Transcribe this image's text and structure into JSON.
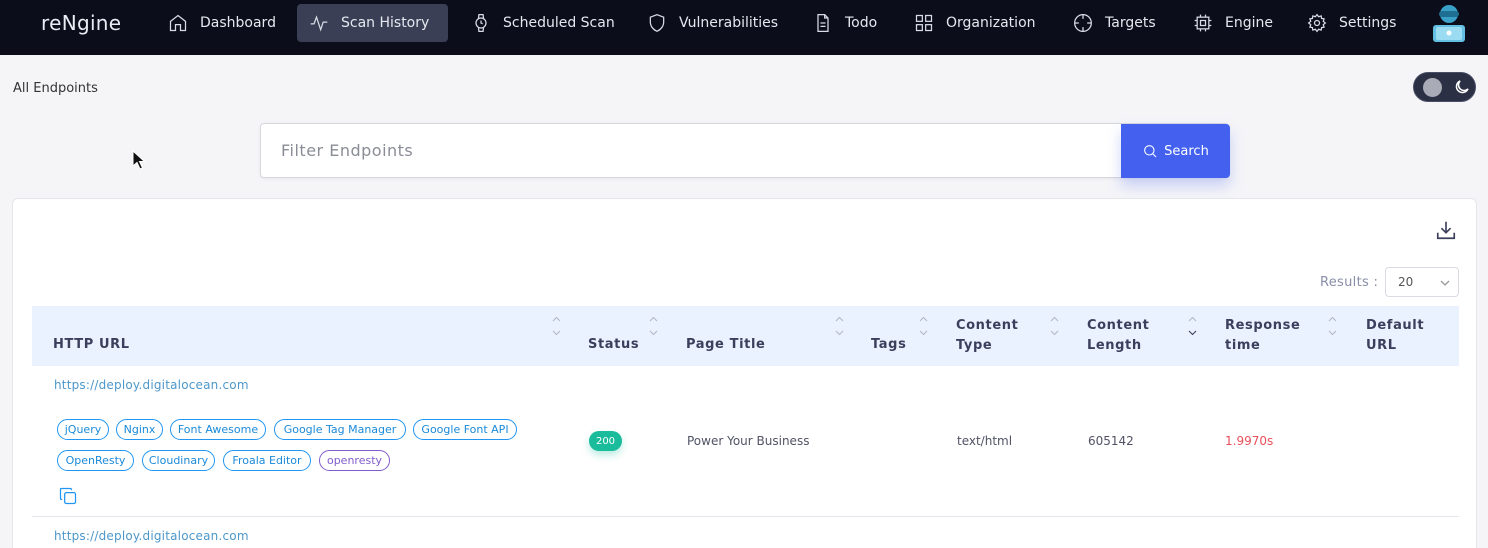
{
  "app": {
    "brand": "reNgine"
  },
  "nav": {
    "dashboard": "Dashboard",
    "scan_history": "Scan History",
    "scheduled_scan": "Scheduled Scan",
    "vulnerabilities": "Vulnerabilities",
    "todo": "Todo",
    "organization": "Organization",
    "targets": "Targets",
    "engine": "Engine",
    "settings": "Settings"
  },
  "page": {
    "title": "All Endpoints"
  },
  "search": {
    "placeholder": "Filter Endpoints",
    "value": "",
    "button_label": "Search"
  },
  "results": {
    "label": "Results :",
    "selected": "20"
  },
  "table": {
    "columns": {
      "http_url": "HTTP URL",
      "status": "Status",
      "page_title": "Page Title",
      "tags": "Tags",
      "content_type_1": "Content",
      "content_type_2": "Type",
      "content_length_1": "Content",
      "content_length_2": "Length",
      "response_time_1": "Response",
      "response_time_2": "time",
      "default_url_1": "Default",
      "default_url_2": "URL"
    },
    "rows": [
      {
        "url": "https://deploy.digitalocean.com",
        "technologies": [
          "jQuery",
          "Nginx",
          "Font Awesome",
          "Google Tag Manager",
          "Google Font API",
          "OpenResty",
          "Cloudinary",
          "Froala Editor",
          "openresty"
        ],
        "status": "200",
        "page_title": "Power Your Business",
        "tags": "",
        "content_type": "text/html",
        "content_length": "605142",
        "response_time": "1.9970s",
        "default_url": ""
      },
      {
        "url": "https://deploy.digitalocean.com"
      }
    ]
  },
  "colors": {
    "navbar": "#0b0e1a",
    "active_nav": "#3a3f55",
    "primary": "#4361ee",
    "table_header": "#eaf1ff",
    "link": "#4d97c9",
    "tag_blue": "#2196f3",
    "tag_purple": "#805dca",
    "status_success": "#1abc9c",
    "response_time": "#e7515a"
  },
  "icons": {
    "dashboard": "home-icon",
    "scan_history": "activity-icon",
    "scheduled_scan": "watch-icon",
    "vulnerabilities": "shield-icon",
    "todo": "file-text-icon",
    "organization": "grid-icon",
    "targets": "crosshair-icon",
    "engine": "cpu-icon",
    "settings": "gear-icon"
  }
}
